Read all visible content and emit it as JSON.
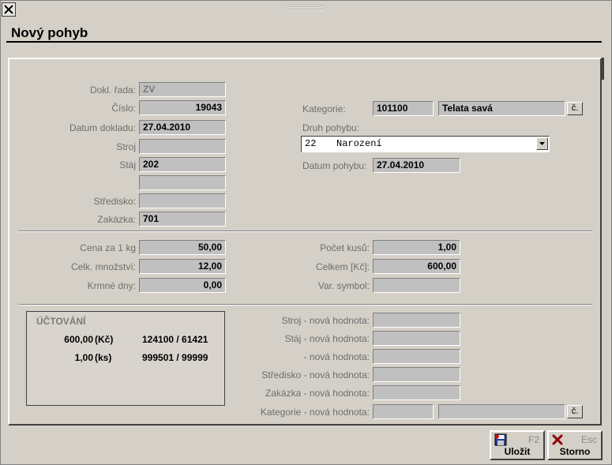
{
  "window": {
    "title": "Nový pohyb"
  },
  "left_fields": [
    {
      "label": "Dokl. řada:",
      "value": "ZV"
    },
    {
      "label": "Číslo:",
      "value": "19043"
    },
    {
      "label": "Datum dokladu:",
      "value": "27.04.2010"
    },
    {
      "label": "Stroj",
      "value": ""
    },
    {
      "label": "Stáj",
      "value": "202"
    },
    {
      "label": "",
      "value": ""
    },
    {
      "label": "Středisko:",
      "value": ""
    },
    {
      "label": "Zakázka:",
      "value": "701"
    }
  ],
  "kategorie": {
    "label": "Kategorie:",
    "code": "101100",
    "name": "Telata savá",
    "button": "č."
  },
  "druh_pohybu": {
    "label": "Druh pohybu:",
    "code": "22",
    "name": "Narození"
  },
  "datum_pohybu": {
    "label": "Datum pohybu:",
    "value": "27.04.2010"
  },
  "amounts_left": [
    {
      "label": "Cena za 1 kg",
      "value": "50,00"
    },
    {
      "label": "Celk. množství:",
      "value": "12,00"
    },
    {
      "label": "Krmné dny:",
      "value": "0,00"
    }
  ],
  "amounts_right": [
    {
      "label": "Počet kusů:",
      "value": "1,00"
    },
    {
      "label": "Celkem [Kč]:",
      "value": "600,00"
    },
    {
      "label": "Var. symbol:",
      "value": ""
    }
  ],
  "uctovani": {
    "title": "ÚČTOVÁNÍ",
    "rows": [
      {
        "amount": "600,00",
        "unit": "(Kč)",
        "accounts": "124100 / 61421"
      },
      {
        "amount": "1,00",
        "unit": "(ks)",
        "accounts": "999501 / 99999"
      }
    ]
  },
  "new_values": [
    {
      "label": "Stroj - nová hodnota:",
      "value": ""
    },
    {
      "label": "Stáj - nová hodnota:",
      "value": ""
    },
    {
      "label": "- nová hodnota:",
      "value": ""
    },
    {
      "label": "Středisko - nová hodnota:",
      "value": ""
    },
    {
      "label": "Zakázka - nová hodnota:",
      "value": ""
    },
    {
      "label": "Kategorie - nová hodnota:",
      "value": "",
      "value2": "",
      "button": "č."
    }
  ],
  "buttons": {
    "save": {
      "label": "Uložit",
      "key": "F2",
      "icon": "save-icon"
    },
    "cancel": {
      "label": "Storno",
      "key": "Esc",
      "icon": "cancel-x-icon"
    }
  },
  "colors": {
    "background": "#d4d0c8",
    "field": "#c0c0c0",
    "label": "#6d6d6d",
    "cancel_icon": "#8b0000"
  }
}
